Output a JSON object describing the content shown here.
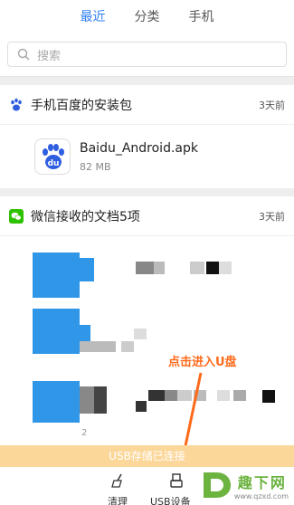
{
  "tabs": [
    "最近",
    "分类",
    "手机"
  ],
  "search": {
    "placeholder": "搜索"
  },
  "sections": [
    {
      "title": "手机百度的安装包",
      "time": "3天前",
      "file": {
        "name": "Baidu_Android.apk",
        "size": "82 MB",
        "icon_text": "du"
      }
    },
    {
      "title": "微信接收的文档5项",
      "time": "3天前"
    }
  ],
  "partial_text": "2",
  "annotation": "点击进入U盘",
  "usb_bar": "USB存储已连接",
  "bottom_bar": {
    "clean_label": "清理",
    "usb_label": "USB设备"
  },
  "watermark": {
    "brand": "趣下网",
    "url": "www.qzxd.com"
  },
  "colors": {
    "accent": "#2f7ff5",
    "annotation": "#ff6a1a",
    "usb_bar": "#fbd79a",
    "wechat": "#2dc100"
  }
}
